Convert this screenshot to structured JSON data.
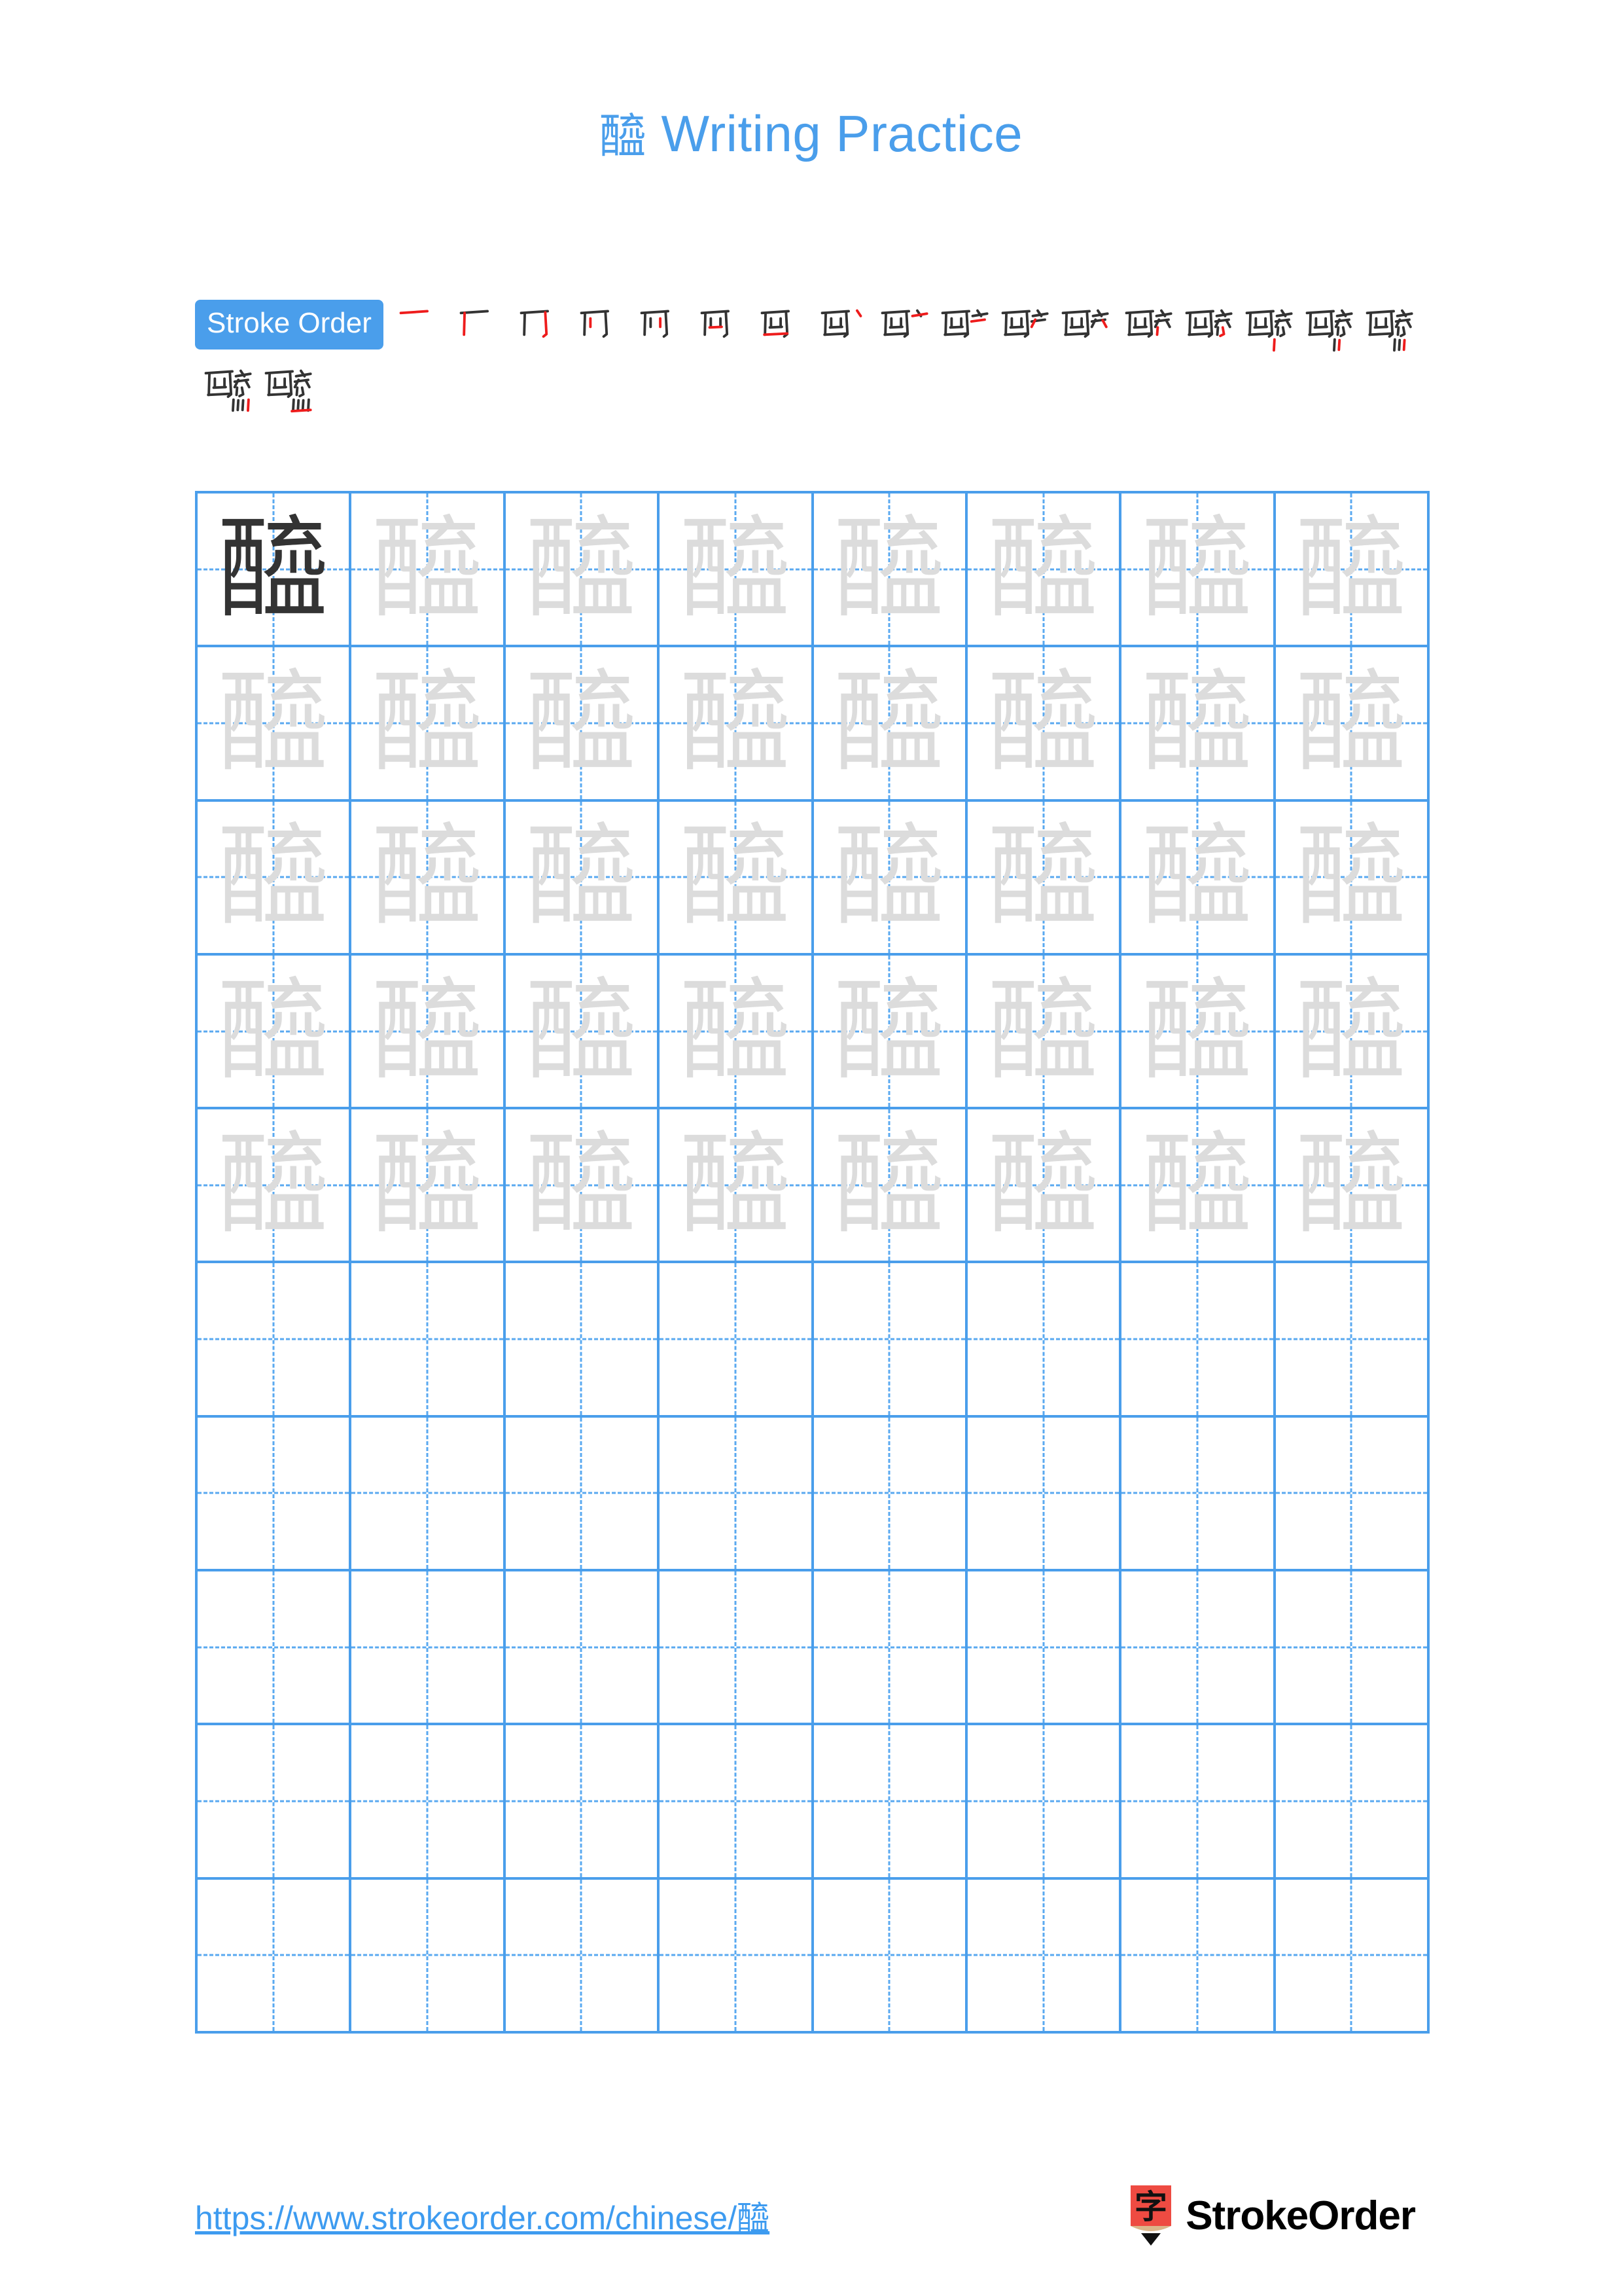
{
  "page": {
    "character": "醯",
    "background_color": "#ffffff",
    "accent_color": "#4a9eeb"
  },
  "header": {
    "title_character": "醯",
    "title_text": " Writing Practice",
    "title_full": "醯 Writing Practice",
    "title_color": "#4a9eeb"
  },
  "stroke_order": {
    "badge_label": "Stroke Order",
    "badge_bg": "#4a9eeb",
    "badge_text_color": "#ffffff",
    "total_strokes": 19,
    "ink_color": "#333333",
    "new_stroke_color": "#ee1c1c",
    "row1_count": 12,
    "row2_count": 7,
    "steps": [
      {
        "index": 1,
        "partial": "一"
      },
      {
        "index": 2,
        "partial": "厂"
      },
      {
        "index": 3,
        "partial": "丆"
      },
      {
        "index": 4,
        "partial": "丙"
      },
      {
        "index": 5,
        "partial": "丙"
      },
      {
        "index": 6,
        "partial": "西"
      },
      {
        "index": 7,
        "partial": "酉"
      },
      {
        "index": 8,
        "partial": "酉丶"
      },
      {
        "index": 9,
        "partial": "酉亠"
      },
      {
        "index": 10,
        "partial": "酉"
      },
      {
        "index": 11,
        "partial": "酉亠"
      },
      {
        "index": 12,
        "partial": "醉"
      },
      {
        "index": 13,
        "partial": "醯"
      },
      {
        "index": 14,
        "partial": "醯"
      },
      {
        "index": 15,
        "partial": "醯"
      },
      {
        "index": 16,
        "partial": "醯"
      },
      {
        "index": 17,
        "partial": "醯"
      },
      {
        "index": 18,
        "partial": "醯"
      },
      {
        "index": 19,
        "partial": "醯"
      }
    ]
  },
  "practice_grid": {
    "columns": 8,
    "rows": 10,
    "filled_rows": 5,
    "empty_rows": 5,
    "border_color": "#4a9eeb",
    "guide_color": "#5aa9f0",
    "model_char_color": "#333333",
    "trace_char_color": "#dcdcdc",
    "model_cell": {
      "row": 1,
      "col": 1,
      "char": "醯"
    },
    "trace_char": "醯"
  },
  "footer": {
    "url": "https://www.strokeorder.com/chinese/醯",
    "url_color": "#3d9bf0",
    "brand_name": "StrokeOrder",
    "brand_logo_char": "字",
    "brand_logo_color": "#ee4b42",
    "brand_logo_tip_color": "#dbb68a",
    "brand_text_color": "#000000"
  }
}
